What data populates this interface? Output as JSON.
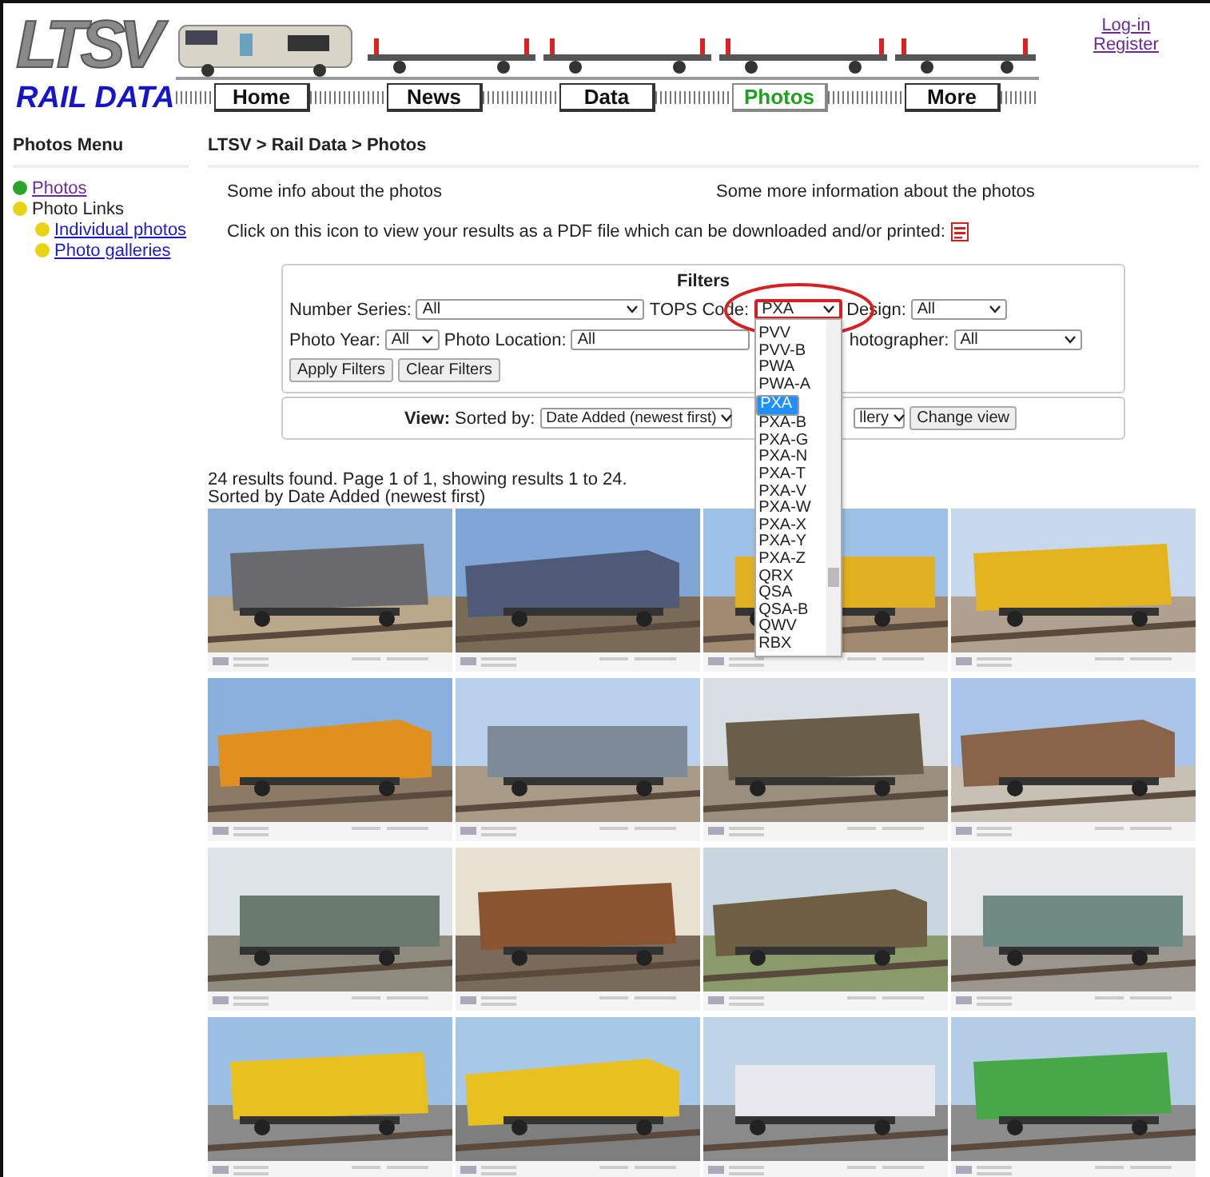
{
  "header": {
    "logo": "LTSV",
    "subtitle": "RAIL DATA",
    "nav": [
      {
        "label": "Home",
        "selected": false
      },
      {
        "label": "News",
        "selected": false
      },
      {
        "label": "Data",
        "selected": false
      },
      {
        "label": "Photos",
        "selected": true
      },
      {
        "label": "More",
        "selected": false
      }
    ],
    "account_links": [
      "Log-in",
      "Register"
    ]
  },
  "sidebar": {
    "title": "Photos Menu",
    "items": [
      {
        "label": "Photos",
        "kind": "visited-link",
        "color": "#2aa52a"
      },
      {
        "label": "Photo Links",
        "kind": "text",
        "color": "#e8d414",
        "children": [
          {
            "label": "Individual photos",
            "kind": "link",
            "color": "#e8d414"
          },
          {
            "label": "Photo galleries",
            "kind": "link",
            "color": "#e8d414"
          }
        ]
      }
    ]
  },
  "breadcrumb": "LTSV > Rail Data > Photos",
  "intro": [
    "Some info about the photos",
    "Some more information about the photos"
  ],
  "pdf_note": "Click on this icon to view your results as a PDF file which can be downloaded and/or printed:",
  "filters": {
    "title": "Filters",
    "number_series": {
      "label": "Number Series:",
      "value": "All"
    },
    "tops_code": {
      "label": "TOPS Code:",
      "value": "PXA",
      "highlighted": true
    },
    "design": {
      "label": "Design:",
      "value": "All"
    },
    "photo_year": {
      "label": "Photo Year:",
      "value": "All"
    },
    "photo_location": {
      "label": "Photo Location:",
      "value": "All"
    },
    "photographer": {
      "label": "hotographer:",
      "value": "All"
    },
    "buttons": [
      "Apply Filters",
      "Clear Filters"
    ],
    "tops_options": [
      {
        "label": "PVV",
        "selected": false
      },
      {
        "label": "PVV-B",
        "selected": false
      },
      {
        "label": "PWA",
        "selected": false
      },
      {
        "label": "PWA-A",
        "selected": false
      },
      {
        "label": "PXA",
        "selected": true
      },
      {
        "label": "PXA-B",
        "selected": false
      },
      {
        "label": "PXA-G",
        "selected": false
      },
      {
        "label": "PXA-N",
        "selected": false
      },
      {
        "label": "PXA-T",
        "selected": false
      },
      {
        "label": "PXA-V",
        "selected": false
      },
      {
        "label": "PXA-W",
        "selected": false
      },
      {
        "label": "PXA-X",
        "selected": false
      },
      {
        "label": "PXA-Y",
        "selected": false
      },
      {
        "label": "PXA-Z",
        "selected": false
      },
      {
        "label": "QRX",
        "selected": false
      },
      {
        "label": "QSA",
        "selected": false
      },
      {
        "label": "QSA-B",
        "selected": false
      },
      {
        "label": "QWV",
        "selected": false
      },
      {
        "label": "RBX",
        "selected": false
      }
    ]
  },
  "view": {
    "label": "View:",
    "sorted_by": "Sorted by:",
    "sort_value": "Date Added (newest first)",
    "layout_value": "llery",
    "button": "Change view"
  },
  "results": [
    "24 results found. Page 1 of 1, showing results 1 to 24.",
    "Sorted by Date Added (newest first)"
  ]
}
